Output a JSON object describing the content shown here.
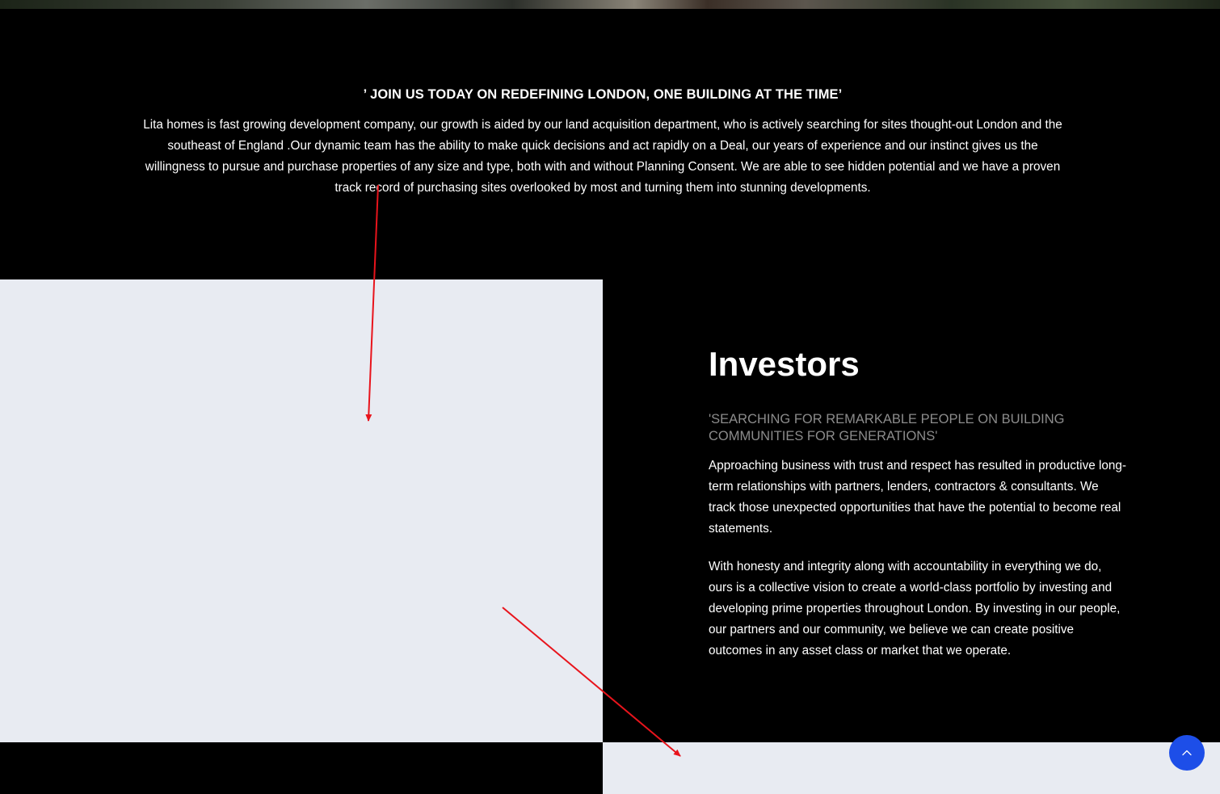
{
  "join_section": {
    "heading": "’ JOIN US TODAY ON REDEFINING LONDON, ONE BUILDING AT THE TIME’",
    "body": "Lita homes is fast growing development company, our growth is aided by our land acquisition department, who is actively searching for sites thought-out London and the southeast of England .Our dynamic team has the ability to make quick decisions and act rapidly on a Deal, our years of experience and our instinct gives us the willingness to pursue and purchase properties of any size and type, both with and without Planning Consent. We are able to see hidden potential and we have a proven track record of purchasing sites overlooked by most and turning them into stunning developments."
  },
  "investors_section": {
    "title": "Investors",
    "subtitle": "'SEARCHING FOR REMARKABLE PEOPLE ON BUILDING COMMUNITIES FOR GENERATIONS'",
    "paragraphs": [
      "Approaching business with trust and respect has resulted in productive long-term relationships with partners, lenders, contractors & consultants. We track those unexpected opportunities that have the potential to become real statements.",
      "With honesty and integrity along with accountability in everything we do, ours is a collective vision to create a world-class portfolio by investing and developing prime properties throughout London.  By investing in our people, our partners and our community, we believe we can create positive outcomes in any asset class or market that we operate."
    ]
  },
  "scroll_top": {
    "icon": "chevron-up-icon"
  },
  "colors": {
    "background": "#000000",
    "panel": "#e8ebf2",
    "subtitle": "#8c8c8c",
    "accent_button": "#1d4ee8",
    "annotation_arrow": "#e8141c"
  }
}
